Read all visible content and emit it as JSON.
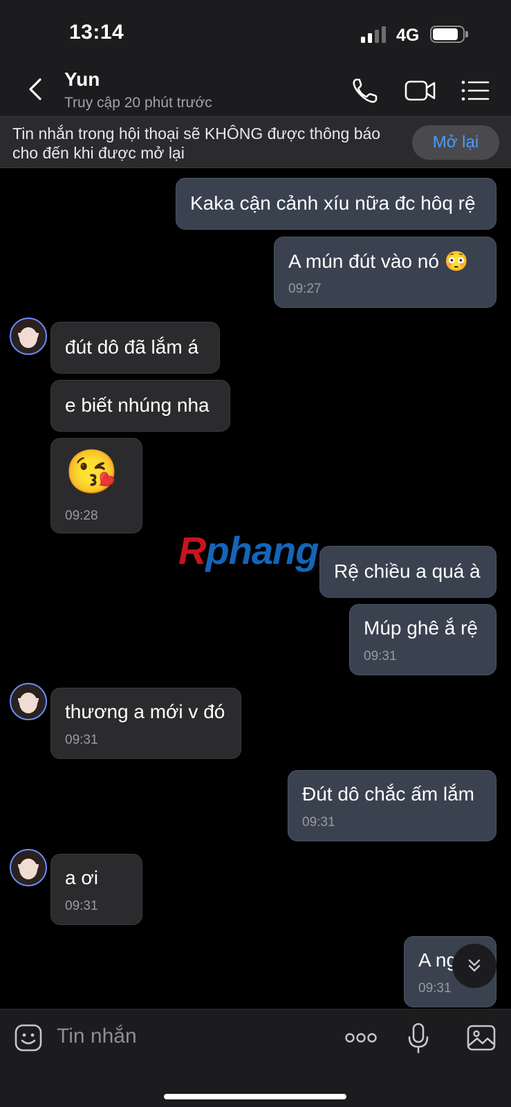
{
  "status_bar": {
    "time": "13:14",
    "network": "4G"
  },
  "header": {
    "back_icon": "chevron-left-icon",
    "contact_name": "Yun",
    "contact_status": "Truy cập 20 phút trước",
    "icons": [
      "phone-icon",
      "video-call-icon",
      "menu-list-icon"
    ]
  },
  "notice": {
    "text": "Tin nhắn trong hội thoại sẽ KHÔNG được thông báo cho đến khi được mở lại",
    "button": "Mở lại"
  },
  "messages": [
    {
      "dir": "out",
      "text": "Kaka cận cảnh xíu nữa đc hôq rệ"
    },
    {
      "dir": "out",
      "text": "A mún đút vào nó 😳",
      "time": "09:27"
    },
    {
      "dir": "in",
      "text": "đút dô đã lắm á"
    },
    {
      "dir": "in",
      "text": "e biết nhúng nha"
    },
    {
      "dir": "in",
      "text": "😘",
      "time": "09:28"
    },
    {
      "dir": "out",
      "text": "Rệ chiều a quá à"
    },
    {
      "dir": "out",
      "text": "Múp ghê ắ rệ",
      "time": "09:31"
    },
    {
      "dir": "in",
      "text": "thương a mới v đó",
      "time": "09:31"
    },
    {
      "dir": "out",
      "text": "Đút dô chắc ấm lắm",
      "time": "09:31"
    },
    {
      "dir": "in",
      "text": "a ơi",
      "time": "09:31"
    },
    {
      "dir": "out",
      "text": "A ng",
      "time": "09:31"
    }
  ],
  "watermark": {
    "first": "R",
    "rest": "phang"
  },
  "input_bar": {
    "placeholder": "Tin nhắn",
    "icons": [
      "sticker-icon",
      "more-icon",
      "microphone-icon",
      "image-icon"
    ]
  },
  "colors": {
    "accent": "#4b9cf5",
    "out_bubble": "#3a4250",
    "in_bubble": "#2b2b2d"
  }
}
